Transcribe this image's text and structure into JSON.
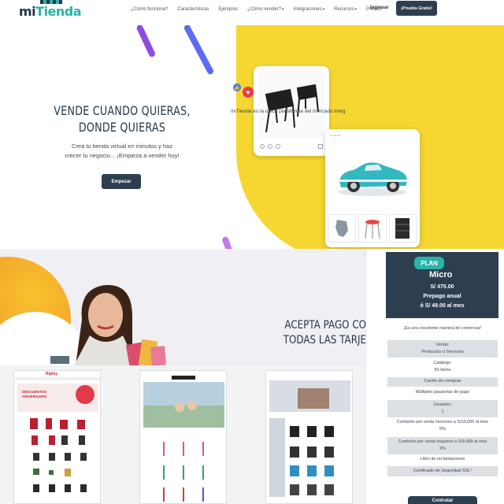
{
  "nav": {
    "logo_mi": "mi",
    "logo_tienda": "Tienda",
    "links": [
      {
        "label": "¿Cómo funciona?",
        "caret": false
      },
      {
        "label": "Características",
        "caret": false
      },
      {
        "label": "Ejemplos",
        "caret": false
      },
      {
        "label": "¿Cómo vender?",
        "caret": true
      },
      {
        "label": "Integraciones",
        "caret": true
      },
      {
        "label": "Recursos",
        "caret": true
      },
      {
        "label": "Precios",
        "caret": false
      }
    ],
    "login": "Ingresar",
    "trial": "¡Prueba Gratis!"
  },
  "hero": {
    "title_line1": "VENDE CUANDO QUIERAS,",
    "title_line2": "DONDE QUIERAS",
    "subtitle_line1": "Crea tu tienda virtual en minutos y haz",
    "subtitle_line2": "crecer tu negocio... ¡Empieza a vender hoy!",
    "cta": "Empezar",
    "shop_card_title": "Tu Tienda"
  },
  "payments": {
    "title_line1": "ACEPTA PAGO CO",
    "title_line2": "TODAS LAS TARJE",
    "subtitle": "miTienda es la única plataforma del mercado integ"
  },
  "plan": {
    "badge": "PLAN",
    "name": "Micro",
    "price": "S/ 470.00",
    "prepay": "Prepago anual",
    "monthly": "ó S/ 49.00 al mes",
    "intro": "¡Es una excelente manera de comenzar!",
    "features": [
      {
        "lines": [
          "Vende:",
          "Productos o Servicios"
        ],
        "shaded": true
      },
      {
        "lines": [
          "Catálogo:",
          "50 items"
        ],
        "shaded": false
      },
      {
        "lines": [
          "Carrito de compras"
        ],
        "shaded": true
      },
      {
        "lines": [
          "Múltiples pasarelas de pago"
        ],
        "shaded": false
      },
      {
        "lines": [
          "Usuarios:",
          "1"
        ],
        "shaded": true
      },
      {
        "lines": [
          "Comisión por venta menores a S/10,000 al mes",
          "0%"
        ],
        "shaded": false
      },
      {
        "lines": [
          "Comisión por venta mayores a S/9,999 al mes",
          "2%"
        ],
        "shaded": true
      },
      {
        "lines": [
          "Libro de reclamaciones"
        ],
        "shaded": false
      },
      {
        "lines": [
          "Certificado de Seguridad SSL¹"
        ],
        "shaded": true
      }
    ],
    "button": "Contratar"
  },
  "examples": {
    "ex1_brand": "Ripley",
    "ex1_banner": "DESCUENTOS ANIVERSARIO"
  },
  "colors": {
    "navy": "#2d3e50",
    "teal": "#2ab3a6",
    "yellow": "#f6d631",
    "salmon": "#e9775b"
  }
}
